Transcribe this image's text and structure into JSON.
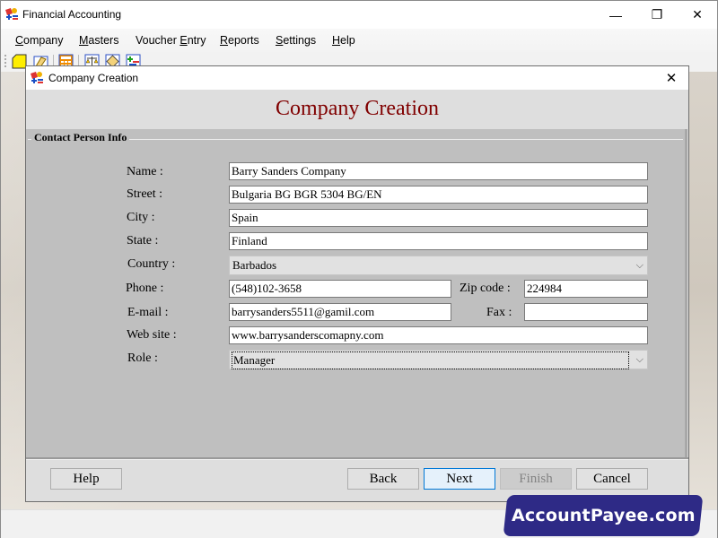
{
  "app": {
    "title": "Financial Accounting",
    "window_controls": {
      "minimize": "—",
      "restore": "❐",
      "close": "✕"
    }
  },
  "menubar": {
    "items": [
      {
        "label": "Company",
        "accel": "C",
        "rest": "ompany"
      },
      {
        "label": "Masters",
        "accel": "M",
        "rest": "asters"
      },
      {
        "label": "Voucher Entry",
        "pre": "Voucher ",
        "accel": "E",
        "rest": "ntry"
      },
      {
        "label": "Reports",
        "accel": "R",
        "rest": "eports"
      },
      {
        "label": "Settings",
        "accel": "S",
        "rest": "ettings"
      },
      {
        "label": "Help",
        "accel": "H",
        "rest": "elp"
      }
    ]
  },
  "toolbar": {
    "icons": [
      "new-document-icon",
      "open-folder-icon",
      "calculator-icon",
      "balance-scale-icon",
      "notepad-icon",
      "add-entry-icon"
    ]
  },
  "dialog": {
    "title": "Company Creation",
    "close": "✕",
    "header": "Company Creation",
    "group_title": "Contact Person Info",
    "fields": {
      "name": {
        "label": "Name :",
        "value": "Barry Sanders Company"
      },
      "street": {
        "label": "Street :",
        "value": "Bulgaria BG BGR 5304 BG/EN"
      },
      "city": {
        "label": "City :",
        "value": "Spain"
      },
      "state": {
        "label": "State :",
        "value": "Finland"
      },
      "country": {
        "label": "Country :",
        "value": "Barbados"
      },
      "phone": {
        "label": "Phone :",
        "value": "(548)102-3658"
      },
      "zip": {
        "label": "Zip code :",
        "value": "224984"
      },
      "email": {
        "label": "E-mail :",
        "value": "barrysanders5511@gamil.com"
      },
      "fax": {
        "label": "Fax :",
        "value": ""
      },
      "website": {
        "label": "Web site :",
        "value": "www.barrysanderscomapny.com"
      },
      "role": {
        "label": "Role :",
        "value": "Manager"
      }
    },
    "buttons": {
      "help": "Help",
      "back": "Back",
      "next": "Next",
      "finish": "Finish",
      "cancel": "Cancel"
    }
  },
  "branding": {
    "text": "AccountPayee.com",
    "color": "#2e2a86"
  },
  "colors": {
    "header_title": "#800000",
    "panel_bg": "#bfbfbf",
    "default_button_border": "#0078d7"
  }
}
